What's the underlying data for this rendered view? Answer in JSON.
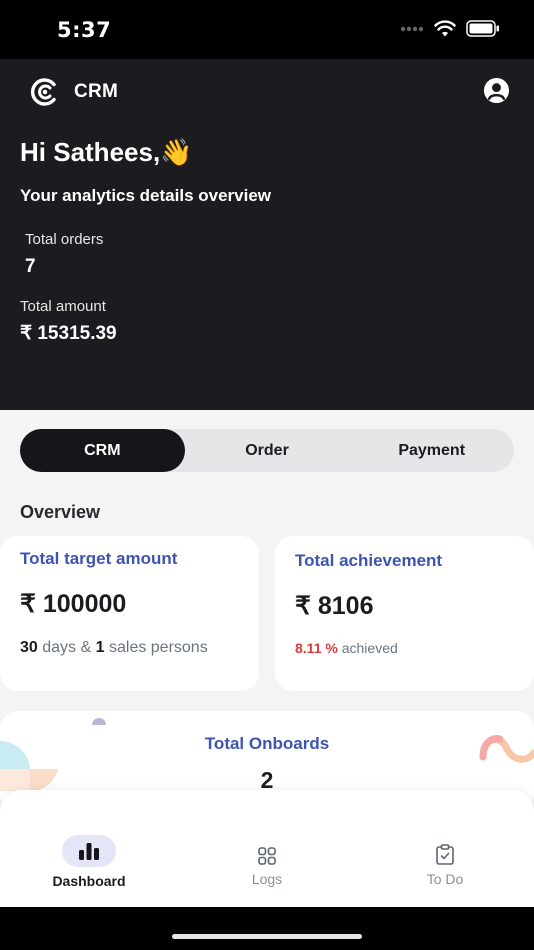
{
  "status_bar": {
    "time": "5:37"
  },
  "header": {
    "brand": "CRM",
    "greeting": "Hi Sathees,👋",
    "subtitle": "Your analytics details overview",
    "stats": [
      {
        "label": "Total orders",
        "value": "7"
      },
      {
        "label": "Total amount",
        "value": "₹ 15315.39"
      }
    ]
  },
  "tabs": [
    {
      "label": "CRM",
      "active": true
    },
    {
      "label": "Order",
      "active": false
    },
    {
      "label": "Payment",
      "active": false
    }
  ],
  "overview": {
    "title": "Overview",
    "target": {
      "title": "Total target amount",
      "amount": "₹ 100000",
      "days": "30",
      "days_text": "days &",
      "persons": "1",
      "persons_text": "sales persons"
    },
    "achievement": {
      "title": "Total achievement",
      "amount": "₹ 8106",
      "percent": "8.11 %",
      "achieved_text": "achieved"
    },
    "onboards": {
      "title": "Total Onboards",
      "count": "2"
    }
  },
  "bottom_nav": [
    {
      "label": "Dashboard",
      "icon": "bar-chart-icon",
      "active": true
    },
    {
      "label": "Logs",
      "icon": "grid-icon",
      "active": false
    },
    {
      "label": "To Do",
      "icon": "clipboard-check-icon",
      "active": false
    }
  ],
  "colors": {
    "header_bg": "#1c1c20",
    "accent_blue": "#3d55b0",
    "percent_red": "#e0393e",
    "active_pill": "#e4e6f7"
  }
}
